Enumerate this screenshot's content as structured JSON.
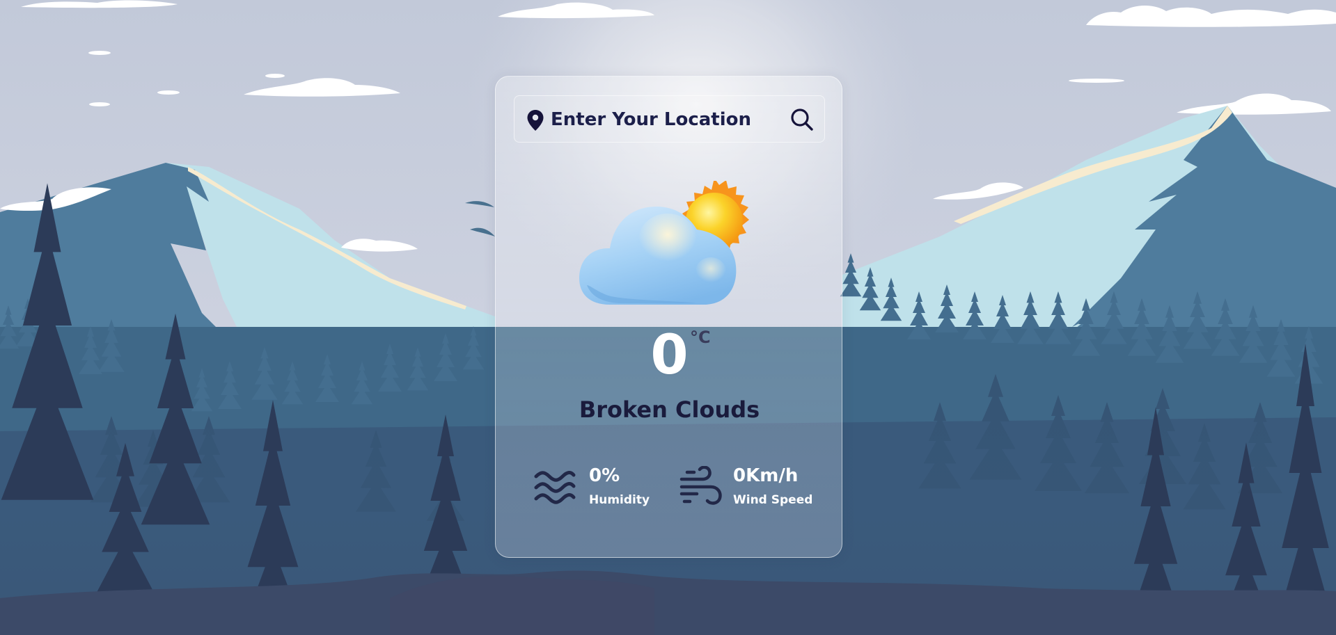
{
  "search": {
    "placeholder": "Enter Your Location",
    "value": ""
  },
  "weather": {
    "temperature": "0",
    "unit": "°C",
    "condition": "Broken Clouds",
    "icon": "cloud-sun-icon"
  },
  "details": {
    "humidity": {
      "value": "0%",
      "label": "Humidity",
      "icon": "waves-icon"
    },
    "wind": {
      "value": "0Km/h",
      "label": "Wind Speed",
      "icon": "wind-icon"
    }
  },
  "colors": {
    "sky": "#c8cedd",
    "mountain_dark": "#4e7c9e",
    "mountain_light": "#bfe1ea",
    "forest_mid": "#3f6888",
    "forest_dark": "#2c3a56",
    "text_dark": "#1a1b3c",
    "text_light": "#ffffff",
    "sun": "#f7b419"
  }
}
